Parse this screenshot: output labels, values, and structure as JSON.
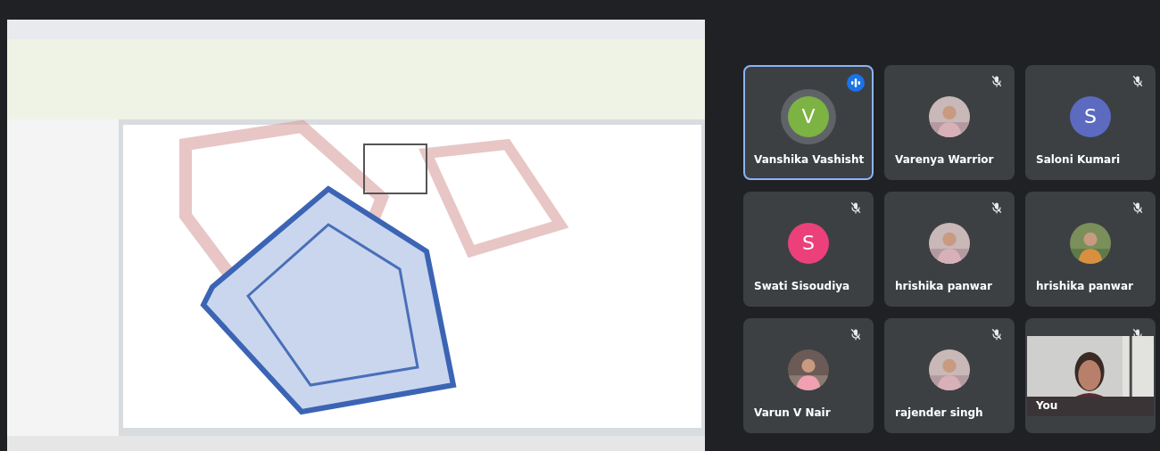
{
  "participants": [
    {
      "name": "Vanshika Vashisht",
      "avatar": {
        "kind": "letter",
        "letter": "V",
        "color": "#7cb342"
      },
      "speaking": true,
      "muted": false
    },
    {
      "name": "Varenya Warrior",
      "speaking": false,
      "muted": true
    },
    {
      "name": "Saloni Kumari",
      "avatar": {
        "kind": "letter",
        "letter": "S",
        "color": "#5c6bc0"
      },
      "speaking": false,
      "muted": true
    },
    {
      "name": "Swati Sisoudiya",
      "avatar": {
        "kind": "letter",
        "letter": "S",
        "color": "#ec407a"
      },
      "speaking": false,
      "muted": true
    },
    {
      "name": "hrishika panwar",
      "speaking": false,
      "muted": true
    },
    {
      "name": "hrishika panwar",
      "speaking": false,
      "muted": true
    },
    {
      "name": "Varun V Nair",
      "speaking": false,
      "muted": true
    },
    {
      "name": "rajender singh",
      "speaking": false,
      "muted": true
    },
    {
      "name": "You",
      "avatar": {
        "kind": "video"
      },
      "speaking": false,
      "muted": true
    }
  ]
}
